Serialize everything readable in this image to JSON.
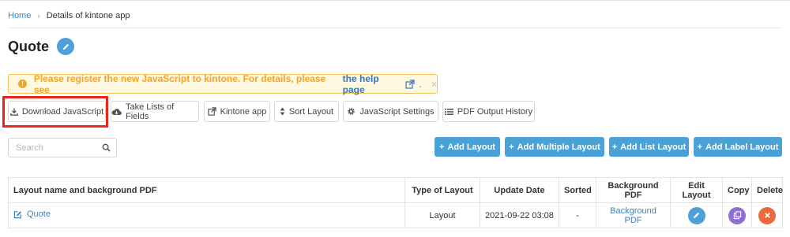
{
  "breadcrumb": {
    "home": "Home",
    "separator": "›",
    "current": "Details of kintone app"
  },
  "page": {
    "title": "Quote"
  },
  "alert": {
    "warn_glyph": "!",
    "message": "Please register the new JavaScript to kintone. For details, please see",
    "link": "the help page",
    "period": ".",
    "close": "×"
  },
  "toolbar": {
    "download_js": "Download JavaScript",
    "take_lists": "Take Lists of Fields",
    "kintone_app": "Kintone app",
    "sort_layout": "Sort Layout",
    "js_settings": "JavaScript Settings",
    "pdf_history": "PDF Output History"
  },
  "search": {
    "placeholder": "Search"
  },
  "actions": {
    "plus": "+",
    "add_layout": "Add Layout",
    "add_multiple_layout": "Add Multiple Layout",
    "add_list_layout": "Add List Layout",
    "add_label_layout": "Add Label Layout"
  },
  "table": {
    "headers": [
      "Layout name and background PDF",
      "Type of Layout",
      "Update Date",
      "Sorted",
      "Background PDF",
      "Edit Layout",
      "Copy",
      "Delete"
    ],
    "rows": [
      {
        "name": "Quote",
        "type": "Layout",
        "date": "2021-09-22 03:08",
        "sorted": "-",
        "background_pdf": "Background PDF"
      }
    ]
  },
  "colors": {
    "accent": "#4aa1d6",
    "warning": "#f2a42a",
    "link": "#3a83c5",
    "highlight": "#e8261d",
    "copy": "#8f6fd0",
    "delete": "#ea6a3d"
  }
}
